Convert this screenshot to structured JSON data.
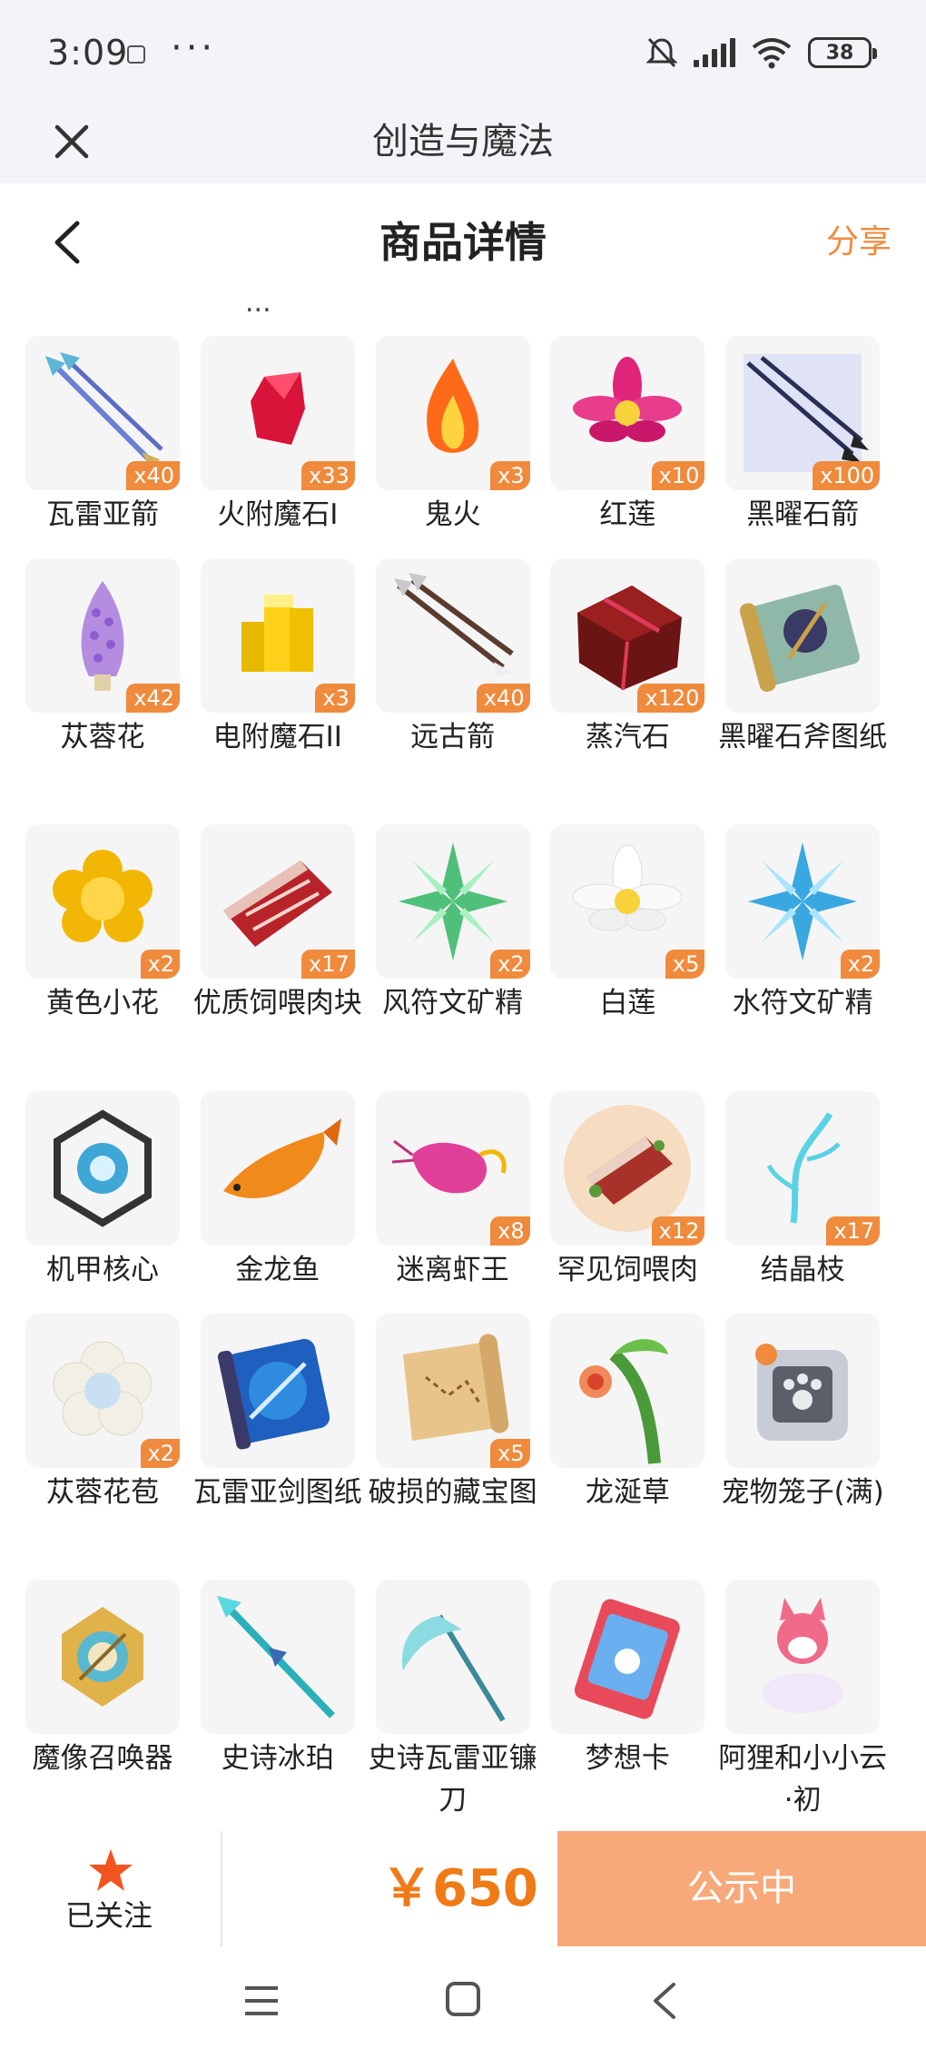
{
  "status_bar": {
    "time": "3:09",
    "more": "···",
    "battery": "38"
  },
  "app_header": {
    "title": "创造与魔法"
  },
  "nav": {
    "title": "商品详情",
    "share": "分享"
  },
  "content": {
    "cut_text": "..."
  },
  "items": [
    {
      "name": "瓦雷亚箭",
      "count": "x40",
      "icon": "arrow-pair-icon"
    },
    {
      "name": "火附魔石I",
      "count": "x33",
      "icon": "red-crystal-icon"
    },
    {
      "name": "鬼火",
      "count": "x3",
      "icon": "flame-icon"
    },
    {
      "name": "红莲",
      "count": "x10",
      "icon": "red-lotus-icon"
    },
    {
      "name": "黑曜石箭",
      "count": "x100",
      "icon": "obsidian-arrow-icon"
    },
    {
      "name": "苁蓉花",
      "count": "x42",
      "icon": "cistanche-flower-icon"
    },
    {
      "name": "电附魔石II",
      "count": "x3",
      "icon": "yellow-crystal-icon"
    },
    {
      "name": "远古箭",
      "count": "x40",
      "icon": "ancient-arrow-icon"
    },
    {
      "name": "蒸汽石",
      "count": "x120",
      "icon": "steam-stone-icon"
    },
    {
      "name": "黑曜石斧图纸",
      "count": "",
      "icon": "axe-blueprint-icon"
    },
    {
      "name": "黄色小花",
      "count": "x2",
      "icon": "yellow-flower-icon"
    },
    {
      "name": "优质饲喂肉块",
      "count": "x17",
      "icon": "meat-icon"
    },
    {
      "name": "风符文矿精",
      "count": "x2",
      "icon": "green-crystal-icon"
    },
    {
      "name": "白莲",
      "count": "x5",
      "icon": "white-lotus-icon"
    },
    {
      "name": "水符文矿精",
      "count": "x2",
      "icon": "blue-crystal-icon"
    },
    {
      "name": "机甲核心",
      "count": "",
      "icon": "mech-core-icon"
    },
    {
      "name": "金龙鱼",
      "count": "",
      "icon": "golden-fish-icon"
    },
    {
      "name": "迷离虾王",
      "count": "x8",
      "icon": "shrimp-icon"
    },
    {
      "name": "罕见饲喂肉",
      "count": "x12",
      "icon": "rare-meat-icon"
    },
    {
      "name": "结晶枝",
      "count": "x17",
      "icon": "crystal-branch-icon"
    },
    {
      "name": "苁蓉花苞",
      "count": "x2",
      "icon": "flower-bud-icon"
    },
    {
      "name": "瓦雷亚剑图纸",
      "count": "",
      "icon": "sword-blueprint-icon"
    },
    {
      "name": "破损的藏宝图",
      "count": "x5",
      "icon": "treasure-map-icon"
    },
    {
      "name": "龙涎草",
      "count": "",
      "icon": "dragon-herb-icon"
    },
    {
      "name": "宠物笼子(满)",
      "count": "",
      "icon": "pet-cage-icon"
    },
    {
      "name": "魔像召唤器",
      "count": "",
      "icon": "golem-summoner-icon"
    },
    {
      "name": "史诗冰珀",
      "count": "",
      "icon": "ice-spear-icon"
    },
    {
      "name": "史诗瓦雷亚镰刀",
      "count": "",
      "icon": "scythe-icon"
    },
    {
      "name": "梦想卡",
      "count": "",
      "icon": "dream-card-icon"
    },
    {
      "name": "阿狸和小小云·初",
      "count": "",
      "icon": "fox-cloud-icon"
    }
  ],
  "bottom_bar": {
    "follow_label": "已关注",
    "price": "￥650",
    "status_button": "公示中"
  },
  "colors": {
    "accent": "#f08a3c",
    "price": "#f07a16",
    "status_button": "#f8a979",
    "header_bg": "#f2f4f7"
  }
}
